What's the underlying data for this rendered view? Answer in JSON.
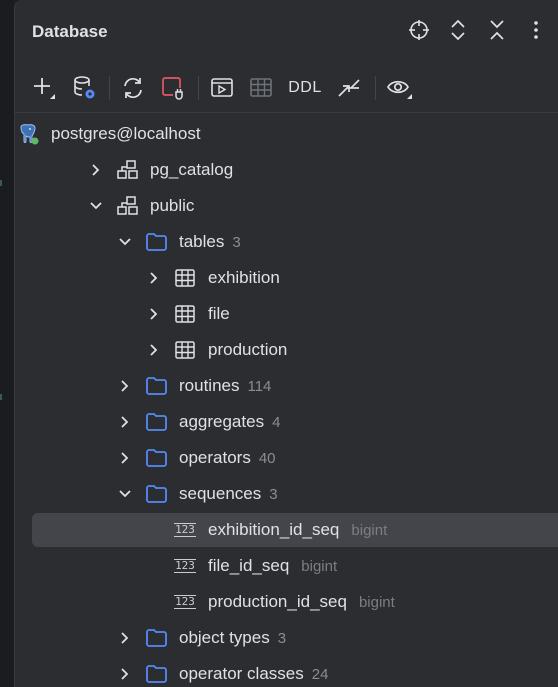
{
  "panel": {
    "title": "Database"
  },
  "header_icons": [
    "crosshair-icon",
    "expand-icon",
    "collapse-icon",
    "more-vertical-icon"
  ],
  "toolbar": {
    "ddl_label": "DDL",
    "icons": [
      "add-icon",
      "data-source-properties-icon",
      "refresh-icon",
      "disconnect-icon",
      "query-console-icon",
      "table-view-icon",
      "ddl",
      "jump-to-source-icon",
      "view-options-icon"
    ]
  },
  "tree": {
    "root": {
      "label": "postgres@localhost",
      "icon": "postgres-elephant-icon"
    },
    "items": [
      {
        "label": "pg_catalog",
        "count": "",
        "type": "",
        "icon": "schema-icon",
        "expanded": false
      },
      {
        "label": "public",
        "count": "",
        "type": "",
        "icon": "schema-icon",
        "expanded": true
      },
      {
        "label": "tables",
        "count": "3",
        "type": "",
        "icon": "folder-icon",
        "expanded": true
      },
      {
        "label": "exhibition",
        "count": "",
        "type": "",
        "icon": "table-icon",
        "expanded": false
      },
      {
        "label": "file",
        "count": "",
        "type": "",
        "icon": "table-icon",
        "expanded": false
      },
      {
        "label": "production",
        "count": "",
        "type": "",
        "icon": "table-icon",
        "expanded": false
      },
      {
        "label": "routines",
        "count": "114",
        "type": "",
        "icon": "folder-icon",
        "expanded": false
      },
      {
        "label": "aggregates",
        "count": "4",
        "type": "",
        "icon": "folder-icon",
        "expanded": false
      },
      {
        "label": "operators",
        "count": "40",
        "type": "",
        "icon": "folder-icon",
        "expanded": false
      },
      {
        "label": "sequences",
        "count": "3",
        "type": "",
        "icon": "folder-icon",
        "expanded": true
      },
      {
        "label": "exhibition_id_seq",
        "count": "",
        "type": "bigint",
        "icon": "sequence-icon",
        "selected": true
      },
      {
        "label": "file_id_seq",
        "count": "",
        "type": "bigint",
        "icon": "sequence-icon"
      },
      {
        "label": "production_id_seq",
        "count": "",
        "type": "bigint",
        "icon": "sequence-icon"
      },
      {
        "label": "object types",
        "count": "3",
        "type": "",
        "icon": "folder-icon",
        "expanded": false
      },
      {
        "label": "operator classes",
        "count": "24",
        "type": "",
        "icon": "folder-icon",
        "expanded": false
      }
    ],
    "sequence_badge": "123"
  },
  "colors": {
    "background": "#2b2d30",
    "selection": "#43454a",
    "folder": "#548af7",
    "text": "#dfe1e5",
    "muted": "#8a8d93",
    "disconnect": "#e55765",
    "datasource_accent": "#548af7",
    "connected_dot": "#5fb865"
  }
}
